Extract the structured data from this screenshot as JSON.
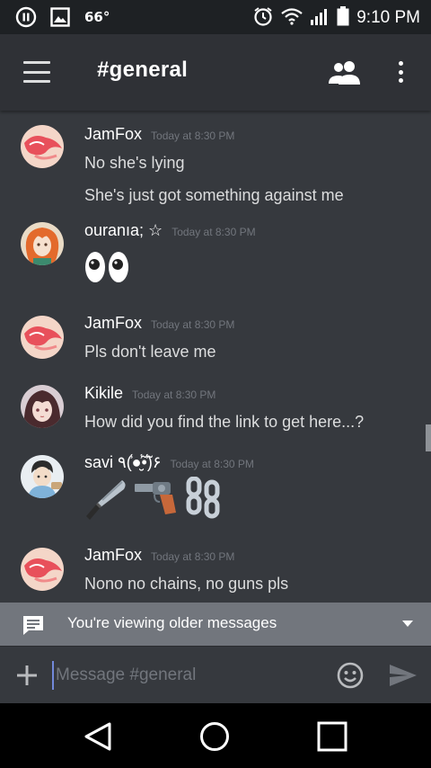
{
  "status_bar": {
    "temperature": "66°",
    "time": "9:10 PM",
    "icons": [
      "pause-circle-icon",
      "image-icon",
      "alarm-icon",
      "wifi-icon",
      "signal-icon",
      "battery-icon"
    ]
  },
  "header": {
    "channel": "#general",
    "icons": [
      "hamburger-menu-icon",
      "members-icon",
      "more-vert-icon"
    ]
  },
  "messages": [
    {
      "author": "JamFox",
      "timestamp": "Today at 8:30 PM",
      "lines": [
        "No she's lying",
        "She's just got something against me"
      ]
    },
    {
      "author": "ouranıa; ☆",
      "timestamp": "Today at 8:30 PM",
      "lines": [
        "👀"
      ]
    },
    {
      "author": "JamFox",
      "timestamp": "Today at 8:30 PM",
      "lines": [
        "Pls don't leave me"
      ]
    },
    {
      "author": "Kikile",
      "timestamp": "Today at 8:30 PM",
      "lines": [
        "How did you find the link to get here...?"
      ]
    },
    {
      "author": "savi ٩(̾●̮̮̃̾•̃̾)۶",
      "timestamp": "Today at 8:30 PM",
      "lines": [
        "🔪🔫⛓"
      ]
    },
    {
      "author": "JamFox",
      "timestamp": "Today at 8:30 PM",
      "lines": [
        "Nono no chains, no guns pls"
      ]
    }
  ],
  "older_banner": {
    "text": "You're viewing older messages"
  },
  "composer": {
    "placeholder": "Message #general"
  },
  "colors": {
    "background": "#36393e",
    "appbar": "#2f3136",
    "banner": "#72767d",
    "accent": "#7289da"
  }
}
